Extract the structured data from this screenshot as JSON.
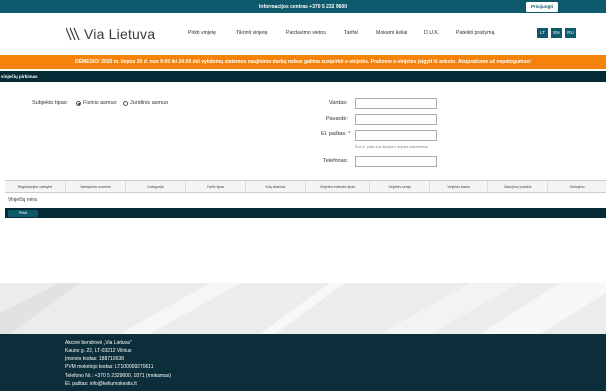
{
  "topbar": {
    "info": "Informacijos centras +370 5 232 9600",
    "login": "Prisijungti"
  },
  "brand": {
    "name": "Via Lietuva"
  },
  "nav": [
    "Pirkti vinjetę",
    "Tikrinti vinjetę",
    "Pardavimo vietos",
    "Tarifai",
    "Mokami keliai",
    "D.U.K.",
    "Pateikti prašymą"
  ],
  "languages": [
    "LT",
    "EN",
    "RU"
  ],
  "alert": "DĖMESIO! 2025 m. liepos 20 d. nuo 9:00 iki 24:00 dėl vykdomų sistemos naujinimo darbų nebus galima susipirkti e-vinjetės. Prašome e-vinjetes įsigyti iš anksto. Atsiprašome už nepatogumus!",
  "section": {
    "title": "vinječių pirkimas"
  },
  "form": {
    "subject_label": "Subjekto tipas:",
    "option_individual": "Fizinis asmuo",
    "option_legal": "Juridinis asmuo",
    "first_name_label": "Vardas:",
    "last_name_label": "Pavardė:",
    "email_label": "El. paštas: *",
    "email_hint": "Šiuo el. paštu bus išsiųsta e-vinjetės patvirtinimas",
    "phone_label": "Telefonas:"
  },
  "table": {
    "columns": [
      "Registracijos valstybė",
      "Valstybinis numeris",
      "Kategorija",
      "Tarifo tipas",
      "Kitų skaičius",
      "Vinjetės trukmės tipas",
      "Vinjetės serija",
      "Vinjetės kaina",
      "Galiojimo pradžia",
      "Galiojimo"
    ],
    "empty": "Vinječių nėra",
    "pay_button": "Pirkti"
  },
  "footer": {
    "company": "Akcinė bendrovė „Via Lietuva“",
    "address": "Kauno g. 22, LT-03212 Vilnius",
    "code": "Įmonės kodas: 188710638",
    "vat": "PVM mokėtojo kodas: LT100009270611",
    "phone": "Telefono Nr.: +370 5 2329600, 1871 (mokamas)",
    "email": "El. paštas: info@keliumokestis.lt"
  },
  "colors": {
    "primary": "#0e5a6c",
    "dark": "#052b37",
    "alert": "#f5820a",
    "footer": "#0c2d3a"
  }
}
